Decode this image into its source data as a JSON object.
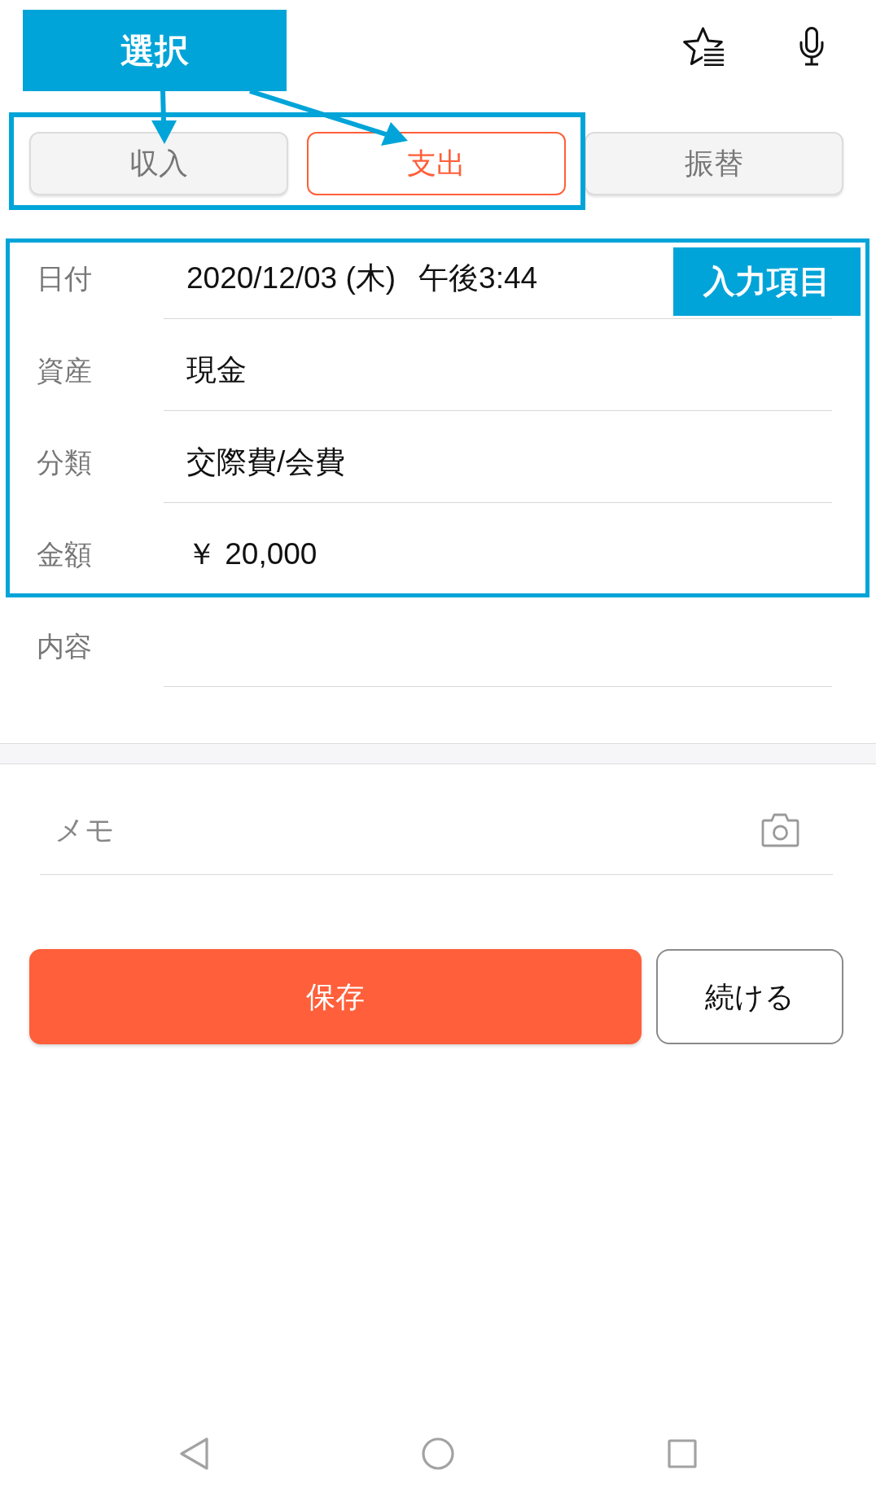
{
  "annotations": {
    "selection_label": "選択",
    "input_label": "入力項目"
  },
  "type_tabs": [
    {
      "label": "収入",
      "selected": false
    },
    {
      "label": "支出",
      "selected": true
    },
    {
      "label": "振替",
      "selected": false
    }
  ],
  "fields": [
    {
      "label": "日付",
      "value": "2020/12/03 (木)",
      "time": "午後3:44"
    },
    {
      "label": "資産",
      "value": "現金"
    },
    {
      "label": "分類",
      "value": "交際費/会費"
    },
    {
      "label": "金額",
      "value": "￥ 20,000"
    },
    {
      "label": "内容"
    }
  ],
  "memo": {
    "placeholder": "メモ"
  },
  "buttons": [
    {
      "label": "保存",
      "kind": "primary"
    },
    {
      "label": "続ける",
      "kind": "secondary"
    }
  ]
}
